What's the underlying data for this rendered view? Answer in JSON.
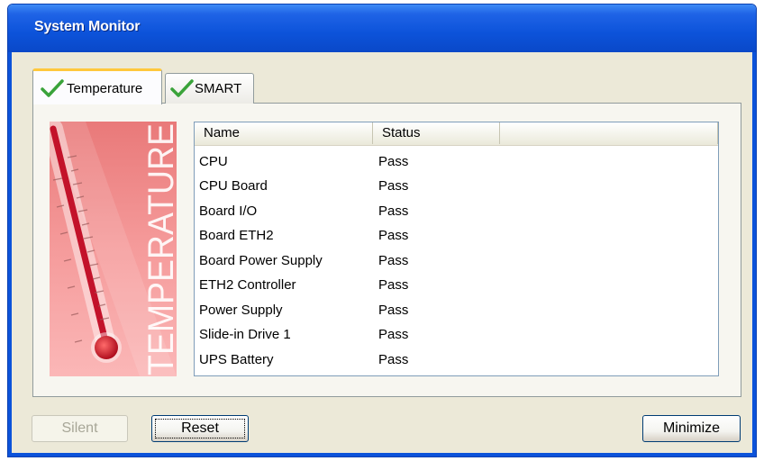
{
  "window": {
    "title": "System Monitor"
  },
  "tabs": [
    {
      "label": "Temperature",
      "active": true,
      "icon": "check-icon"
    },
    {
      "label": "SMART",
      "active": false,
      "icon": "check-icon"
    }
  ],
  "banner": {
    "text": "TEMPERATURE",
    "icon": "thermometer-icon"
  },
  "table": {
    "columns": [
      "Name",
      "Status",
      ""
    ],
    "rows": [
      {
        "name": "CPU",
        "status": "Pass"
      },
      {
        "name": "CPU Board",
        "status": "Pass"
      },
      {
        "name": "Board I/O",
        "status": "Pass"
      },
      {
        "name": "Board ETH2",
        "status": "Pass"
      },
      {
        "name": "Board Power Supply",
        "status": "Pass"
      },
      {
        "name": "ETH2 Controller",
        "status": "Pass"
      },
      {
        "name": "Power Supply",
        "status": "Pass"
      },
      {
        "name": "Slide-in Drive 1",
        "status": "Pass"
      },
      {
        "name": "UPS Battery",
        "status": "Pass"
      }
    ]
  },
  "buttons": {
    "silent": "Silent",
    "reset": "Reset",
    "minimize": "Minimize"
  },
  "colors": {
    "titlebar": "#0c53da",
    "check": "#3aa33a",
    "banner": "#f28b8b",
    "tab_highlight": "#ffc83c"
  }
}
